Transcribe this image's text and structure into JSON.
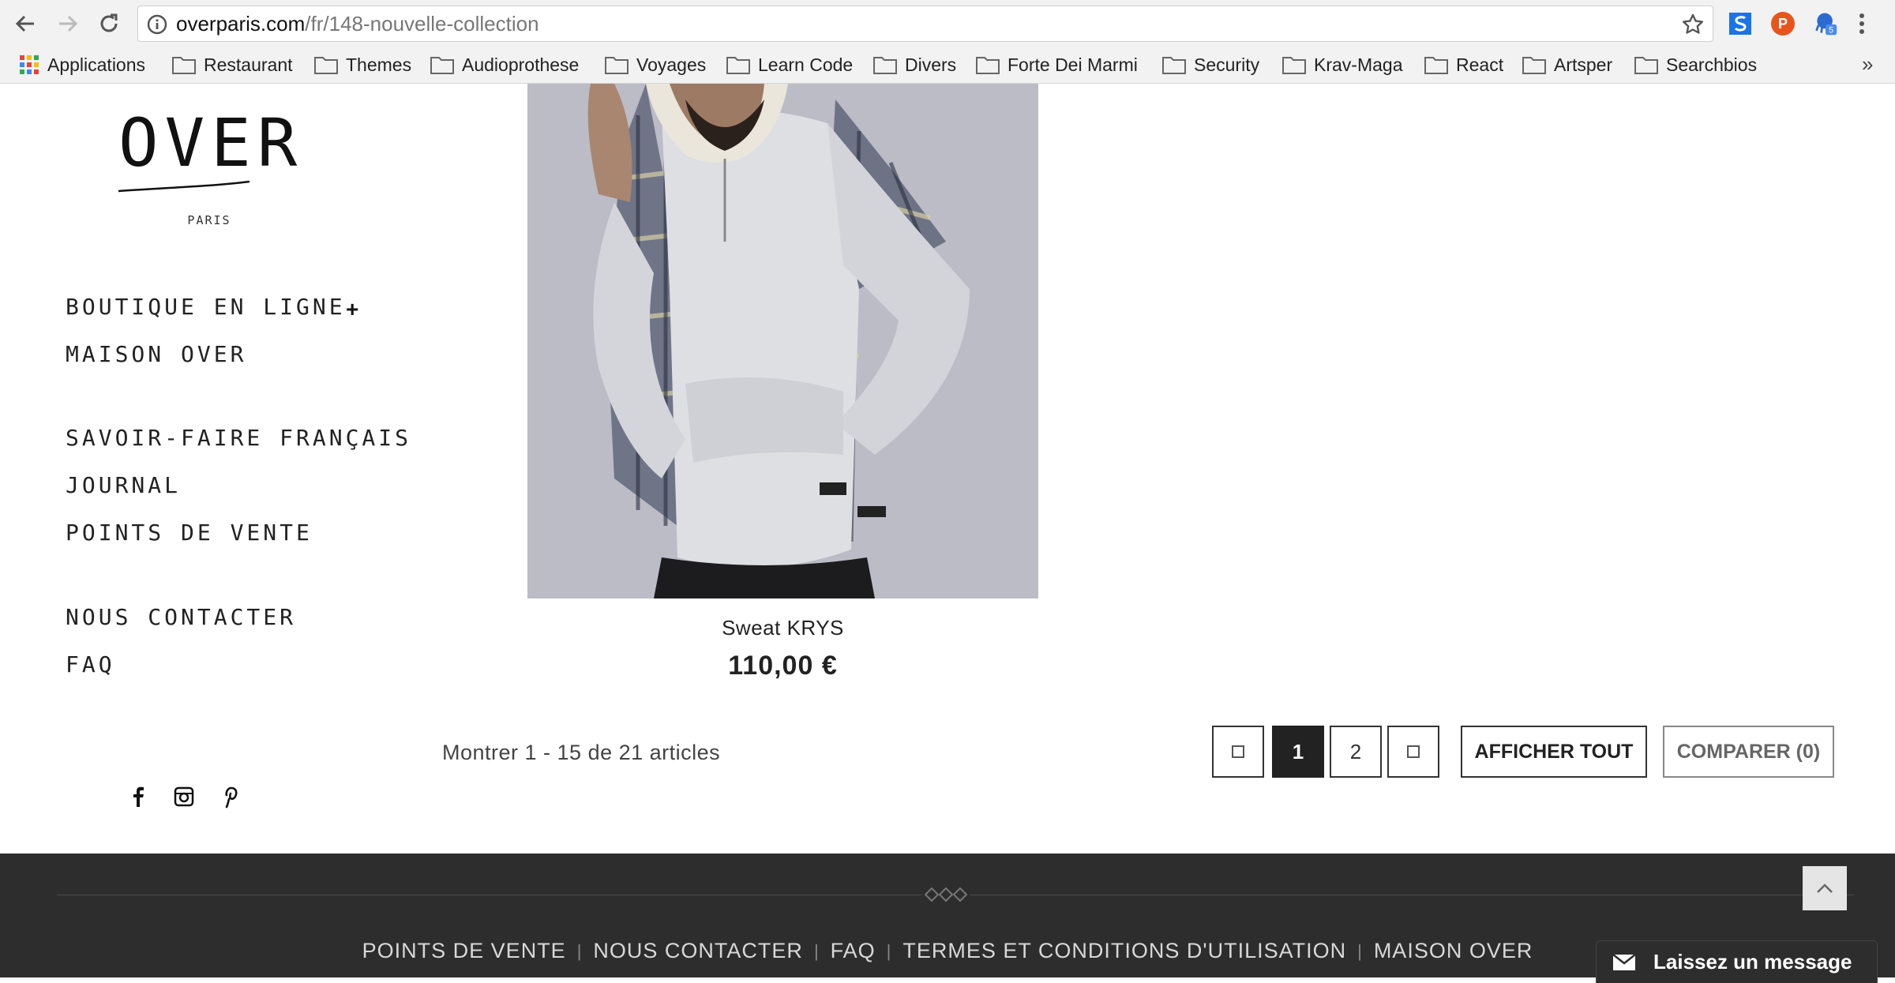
{
  "browser": {
    "url_host": "overparis.com",
    "url_path": "/fr/148-nouvelle-collection",
    "extensions": [
      {
        "name": "s-extension-icon",
        "color": "#1a73e8"
      },
      {
        "name": "p-extension-icon",
        "label": "P",
        "color": "#e8541c"
      },
      {
        "name": "octopus-extension-icon",
        "badge": "5",
        "color": "#2a6ad1"
      }
    ],
    "bookmarks": [
      "Applications",
      "Restaurant",
      "Themes",
      "Audioprothese",
      "Voyages",
      "Learn Code",
      "Divers",
      "Forte Dei Marmi",
      "Security",
      "Krav-Maga",
      "React",
      "Artsper",
      "Searchbios"
    ],
    "bookmarks_more": "»"
  },
  "brand": {
    "logo_text": "OVER",
    "logo_sub": "PARIS"
  },
  "sidebar": {
    "nav": [
      "BOUTIQUE EN LIGNE",
      "MAISON OVER",
      "SAVOIR-FAIRE FRANÇAIS",
      "JOURNAL",
      "POINTS DE VENTE",
      "NOUS CONTACTER",
      "FAQ"
    ],
    "expand_symbol": "+",
    "social": [
      "facebook-icon",
      "instagram-icon",
      "pinterest-icon"
    ]
  },
  "product": {
    "name": "Sweat KRYS",
    "price": "110,00 €"
  },
  "pagination": {
    "summary": "Montrer 1 - 15 de 21 articles",
    "pages": [
      "1",
      "2"
    ],
    "current_page": "1",
    "show_all": "AFFICHER TOUT",
    "compare": "COMPARER (0)"
  },
  "footer": {
    "links": [
      "POINTS DE VENTE",
      "NOUS CONTACTER",
      "FAQ",
      "TERMES ET CONDITIONS D'UTILISATION",
      "MAISON OVER"
    ],
    "separator": "|",
    "chat_label": "Laissez un message"
  },
  "colors": {
    "footer_bg": "#2d2d2d",
    "active_page_bg": "#222222"
  }
}
